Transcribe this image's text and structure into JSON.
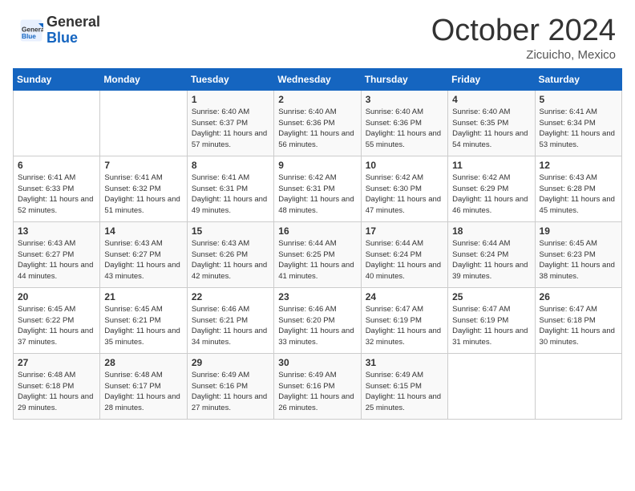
{
  "logo": {
    "general": "General",
    "blue": "Blue"
  },
  "header": {
    "month": "October 2024",
    "location": "Zicuicho, Mexico"
  },
  "days_of_week": [
    "Sunday",
    "Monday",
    "Tuesday",
    "Wednesday",
    "Thursday",
    "Friday",
    "Saturday"
  ],
  "weeks": [
    [
      {
        "day": "",
        "info": ""
      },
      {
        "day": "",
        "info": ""
      },
      {
        "day": "1",
        "info": "Sunrise: 6:40 AM\nSunset: 6:37 PM\nDaylight: 11 hours and 57 minutes."
      },
      {
        "day": "2",
        "info": "Sunrise: 6:40 AM\nSunset: 6:36 PM\nDaylight: 11 hours and 56 minutes."
      },
      {
        "day": "3",
        "info": "Sunrise: 6:40 AM\nSunset: 6:36 PM\nDaylight: 11 hours and 55 minutes."
      },
      {
        "day": "4",
        "info": "Sunrise: 6:40 AM\nSunset: 6:35 PM\nDaylight: 11 hours and 54 minutes."
      },
      {
        "day": "5",
        "info": "Sunrise: 6:41 AM\nSunset: 6:34 PM\nDaylight: 11 hours and 53 minutes."
      }
    ],
    [
      {
        "day": "6",
        "info": "Sunrise: 6:41 AM\nSunset: 6:33 PM\nDaylight: 11 hours and 52 minutes."
      },
      {
        "day": "7",
        "info": "Sunrise: 6:41 AM\nSunset: 6:32 PM\nDaylight: 11 hours and 51 minutes."
      },
      {
        "day": "8",
        "info": "Sunrise: 6:41 AM\nSunset: 6:31 PM\nDaylight: 11 hours and 49 minutes."
      },
      {
        "day": "9",
        "info": "Sunrise: 6:42 AM\nSunset: 6:31 PM\nDaylight: 11 hours and 48 minutes."
      },
      {
        "day": "10",
        "info": "Sunrise: 6:42 AM\nSunset: 6:30 PM\nDaylight: 11 hours and 47 minutes."
      },
      {
        "day": "11",
        "info": "Sunrise: 6:42 AM\nSunset: 6:29 PM\nDaylight: 11 hours and 46 minutes."
      },
      {
        "day": "12",
        "info": "Sunrise: 6:43 AM\nSunset: 6:28 PM\nDaylight: 11 hours and 45 minutes."
      }
    ],
    [
      {
        "day": "13",
        "info": "Sunrise: 6:43 AM\nSunset: 6:27 PM\nDaylight: 11 hours and 44 minutes."
      },
      {
        "day": "14",
        "info": "Sunrise: 6:43 AM\nSunset: 6:27 PM\nDaylight: 11 hours and 43 minutes."
      },
      {
        "day": "15",
        "info": "Sunrise: 6:43 AM\nSunset: 6:26 PM\nDaylight: 11 hours and 42 minutes."
      },
      {
        "day": "16",
        "info": "Sunrise: 6:44 AM\nSunset: 6:25 PM\nDaylight: 11 hours and 41 minutes."
      },
      {
        "day": "17",
        "info": "Sunrise: 6:44 AM\nSunset: 6:24 PM\nDaylight: 11 hours and 40 minutes."
      },
      {
        "day": "18",
        "info": "Sunrise: 6:44 AM\nSunset: 6:24 PM\nDaylight: 11 hours and 39 minutes."
      },
      {
        "day": "19",
        "info": "Sunrise: 6:45 AM\nSunset: 6:23 PM\nDaylight: 11 hours and 38 minutes."
      }
    ],
    [
      {
        "day": "20",
        "info": "Sunrise: 6:45 AM\nSunset: 6:22 PM\nDaylight: 11 hours and 37 minutes."
      },
      {
        "day": "21",
        "info": "Sunrise: 6:45 AM\nSunset: 6:21 PM\nDaylight: 11 hours and 35 minutes."
      },
      {
        "day": "22",
        "info": "Sunrise: 6:46 AM\nSunset: 6:21 PM\nDaylight: 11 hours and 34 minutes."
      },
      {
        "day": "23",
        "info": "Sunrise: 6:46 AM\nSunset: 6:20 PM\nDaylight: 11 hours and 33 minutes."
      },
      {
        "day": "24",
        "info": "Sunrise: 6:47 AM\nSunset: 6:19 PM\nDaylight: 11 hours and 32 minutes."
      },
      {
        "day": "25",
        "info": "Sunrise: 6:47 AM\nSunset: 6:19 PM\nDaylight: 11 hours and 31 minutes."
      },
      {
        "day": "26",
        "info": "Sunrise: 6:47 AM\nSunset: 6:18 PM\nDaylight: 11 hours and 30 minutes."
      }
    ],
    [
      {
        "day": "27",
        "info": "Sunrise: 6:48 AM\nSunset: 6:18 PM\nDaylight: 11 hours and 29 minutes."
      },
      {
        "day": "28",
        "info": "Sunrise: 6:48 AM\nSunset: 6:17 PM\nDaylight: 11 hours and 28 minutes."
      },
      {
        "day": "29",
        "info": "Sunrise: 6:49 AM\nSunset: 6:16 PM\nDaylight: 11 hours and 27 minutes."
      },
      {
        "day": "30",
        "info": "Sunrise: 6:49 AM\nSunset: 6:16 PM\nDaylight: 11 hours and 26 minutes."
      },
      {
        "day": "31",
        "info": "Sunrise: 6:49 AM\nSunset: 6:15 PM\nDaylight: 11 hours and 25 minutes."
      },
      {
        "day": "",
        "info": ""
      },
      {
        "day": "",
        "info": ""
      }
    ]
  ]
}
